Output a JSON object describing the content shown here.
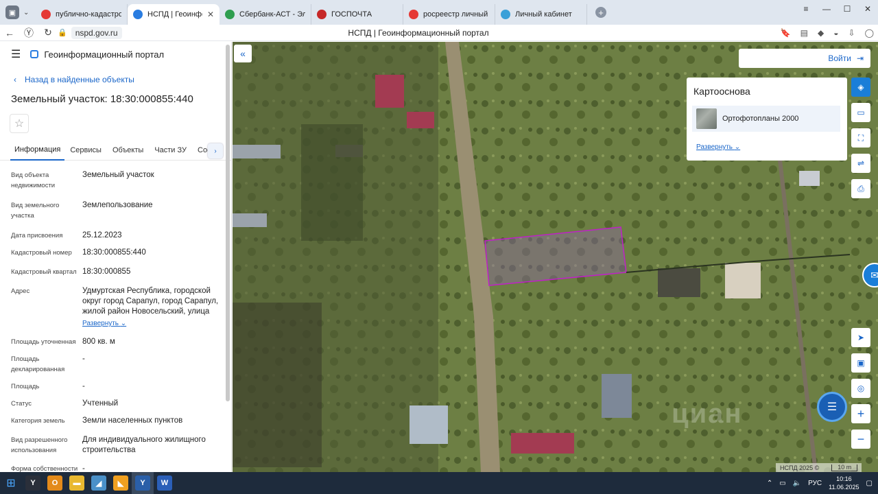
{
  "browser": {
    "tabs": [
      {
        "label": "публично-кадастровая к",
        "color": "#e53935",
        "active": false
      },
      {
        "label": "НСПД | Геоинформаци",
        "color": "#2a7de1",
        "active": true
      },
      {
        "label": "Сбербанк-АСТ - Электро",
        "color": "#2e9e4f",
        "active": false
      },
      {
        "label": "ГОСПОЧТА",
        "color": "#c62828",
        "active": false
      },
      {
        "label": "росреестр личный кабин",
        "color": "#e53935",
        "active": false
      },
      {
        "label": "Личный кабинет",
        "color": "#3aa0d8",
        "active": false
      }
    ],
    "url": "nspd.gov.ru",
    "page_title": "НСПД | Геоинформационный портал"
  },
  "sidebar": {
    "portal_title": "Геоинформационный портал",
    "back_link": "Назад в найденные объекты",
    "object_title": "Земельный участок: 18:30:000855:440",
    "tabs": [
      "Информация",
      "Сервисы",
      "Объекты",
      "Части ЗУ",
      "Соста"
    ],
    "properties": [
      {
        "key": "Вид объекта недвижимости",
        "value": "Земельный участок"
      },
      {
        "key": "Вид земельного участка",
        "value": "Землепользование"
      },
      {
        "key": "Дата присвоения",
        "value": "25.12.2023"
      },
      {
        "key": "Кадастровый номер",
        "value": "18:30:000855:440"
      },
      {
        "key": "Кадастровый квартал",
        "value": "18:30:000855"
      },
      {
        "key": "Адрес",
        "value": "Удмуртская Республика, городской округ город Сарапул, город Сарапул, жилой район Новосельский, улица"
      },
      {
        "key": "Площадь уточненная",
        "value": "800 кв. м"
      },
      {
        "key": "Площадь декларированная",
        "value": "-"
      },
      {
        "key": "Площадь",
        "value": "-"
      },
      {
        "key": "Статус",
        "value": "Учтенный"
      },
      {
        "key": "Категория земель",
        "value": "Земли населенных пунктов"
      },
      {
        "key": "Вид разрешенного использования",
        "value": "Для индивидуального жилищного строительства"
      },
      {
        "key": "Форма собственности",
        "value": "-"
      }
    ],
    "expand_label": "Развернуть"
  },
  "map": {
    "login_label": "Войти",
    "basemap_panel": {
      "title": "Картооснова",
      "item": "Ортофотопланы 2000",
      "expand": "Развернуть"
    },
    "attribution": "НСПД 2025 ©",
    "scale": "10 m",
    "watermark": "циан"
  },
  "taskbar": {
    "lang": "РУС",
    "time": "10:16",
    "date": "11.06.2025"
  }
}
